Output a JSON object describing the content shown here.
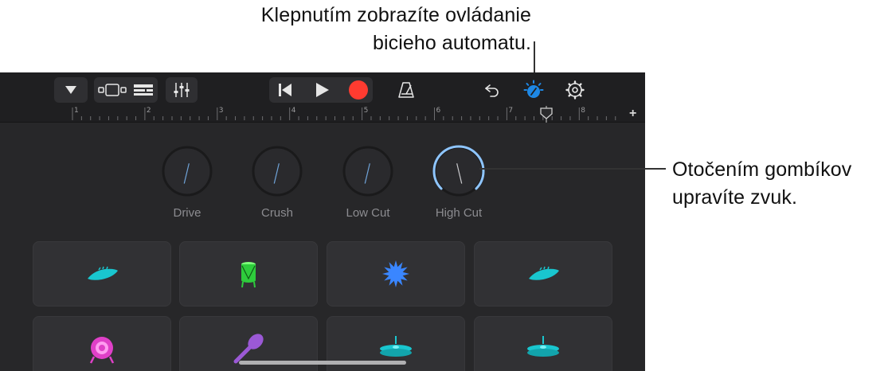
{
  "callouts": {
    "top_line1": "Klepnutím zobrazíte ovládanie",
    "top_line2": "bicieho automatu.",
    "right_line1": "Otočením gombíkov",
    "right_line2": "upravíte zvuk."
  },
  "ruler": {
    "numbers": [
      "1",
      "2",
      "3",
      "4",
      "5",
      "6",
      "7",
      "8"
    ]
  },
  "knobs": [
    {
      "label": "Drive",
      "value": 0.55
    },
    {
      "label": "Crush",
      "value": 0.55
    },
    {
      "label": "Low Cut",
      "value": 0.55
    },
    {
      "label": "High Cut",
      "value": 0.45
    }
  ],
  "pads": [
    {
      "icon": "clap-icon",
      "color": "#19c6cf"
    },
    {
      "icon": "green-drum-icon",
      "color": "#2ecc3c"
    },
    {
      "icon": "burst-icon",
      "color": "#3a86ff"
    },
    {
      "icon": "clap-icon",
      "color": "#19c6cf"
    },
    {
      "icon": "pink-bass-drum-icon",
      "color": "#e040c8"
    },
    {
      "icon": "shaker-icon",
      "color": "#9b59d6"
    },
    {
      "icon": "hihat-icon",
      "color": "#19c6cf"
    },
    {
      "icon": "hihat-icon",
      "color": "#19c6cf"
    }
  ],
  "colors": {
    "accent_blue": "#1e88e5",
    "record_red": "#ff3b30",
    "knob_active": "#8ec5ff"
  }
}
